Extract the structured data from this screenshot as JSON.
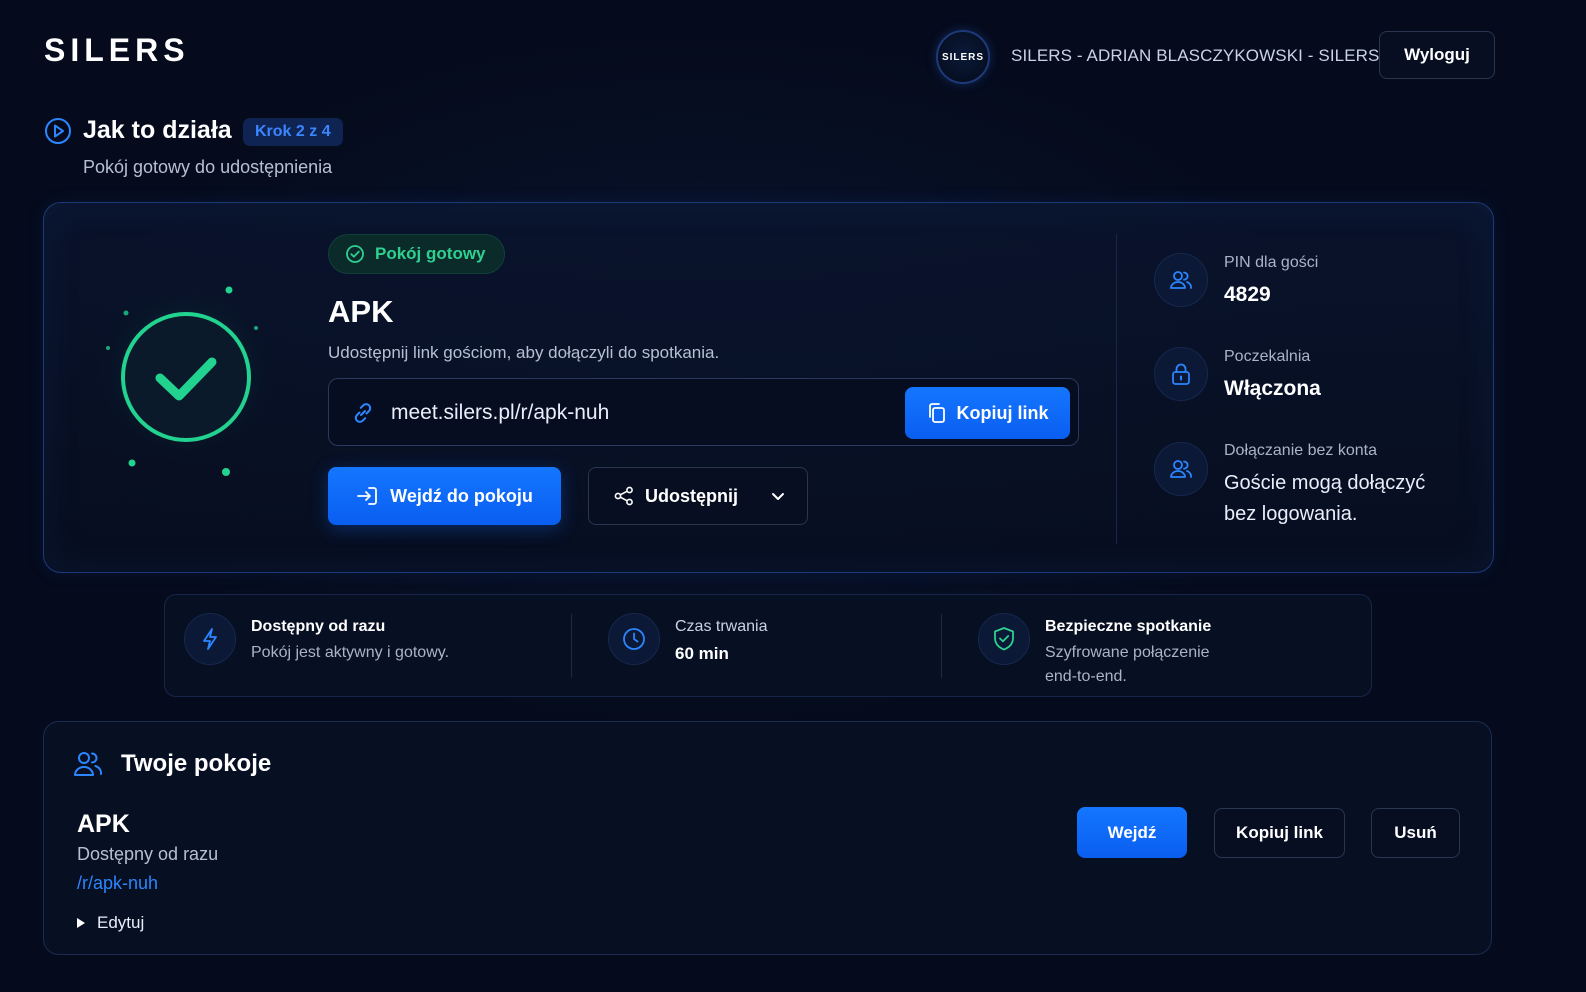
{
  "header": {
    "logo_text": "SILERS",
    "avatar_text": "SILERS",
    "user_name": "SILERS - ADRIAN BLASCZYKOWSKI - SILERS",
    "logout_label": "Wyloguj"
  },
  "step": {
    "title": "Jak to działa",
    "badge": "Krok 2 z 4",
    "subtitle": "Pokój gotowy do udostępnienia"
  },
  "room_card": {
    "status_badge": "Pokój gotowy",
    "name": "APK",
    "description": "Udostępnij link gościom, aby dołączyli do spotkania.",
    "link": "meet.silers.pl/r/apk-nuh",
    "copy_link_label": "Kopiuj link",
    "enter_label": "Wejdź do pokoju",
    "share_label": "Udostępnij"
  },
  "info": {
    "pin_label": "PIN dla gości",
    "pin_value": "4829",
    "waiting_label": "Poczekalnia",
    "waiting_value": "Włączona",
    "guest_label": "Dołączanie bez konta",
    "guest_value_line1": "Goście mogą dołączyć",
    "guest_value_line2": "bez logowania."
  },
  "features": {
    "available_title": "Dostępny od razu",
    "available_sub": "Pokój jest aktywny i gotowy.",
    "duration_title": "Czas trwania",
    "duration_value": "60 min",
    "secure_title": "Bezpieczne spotkanie",
    "secure_sub_line1": "Szyfrowane połączenie",
    "secure_sub_line2": "end-to-end."
  },
  "rooms": {
    "title": "Twoje pokoje",
    "items": [
      {
        "name": "APK",
        "status": "Dostępny od razu",
        "path": "/r/apk-nuh",
        "edit_label": "Edytuj",
        "enter_label": "Wejdź",
        "copy_label": "Kopiuj link",
        "delete_label": "Usuń"
      }
    ]
  },
  "colors": {
    "background": "#050b1c",
    "accent_blue": "#1476ff",
    "success_green": "#2fd08f",
    "card_border": "#1d3a78"
  },
  "icons": {
    "step": "play-circle-icon",
    "status": "check-circle-icon",
    "link": "link-icon",
    "copy": "copy-icon",
    "enter": "login-arrow-icon",
    "share": "share-icon",
    "dropdown": "chevron-down-icon",
    "pin": "users-icon",
    "waiting": "lock-icon",
    "guest": "users-icon",
    "available": "lightning-icon",
    "duration": "clock-icon",
    "secure": "shield-check-icon",
    "rooms": "users-icon",
    "edit": "triangle-right-icon"
  }
}
